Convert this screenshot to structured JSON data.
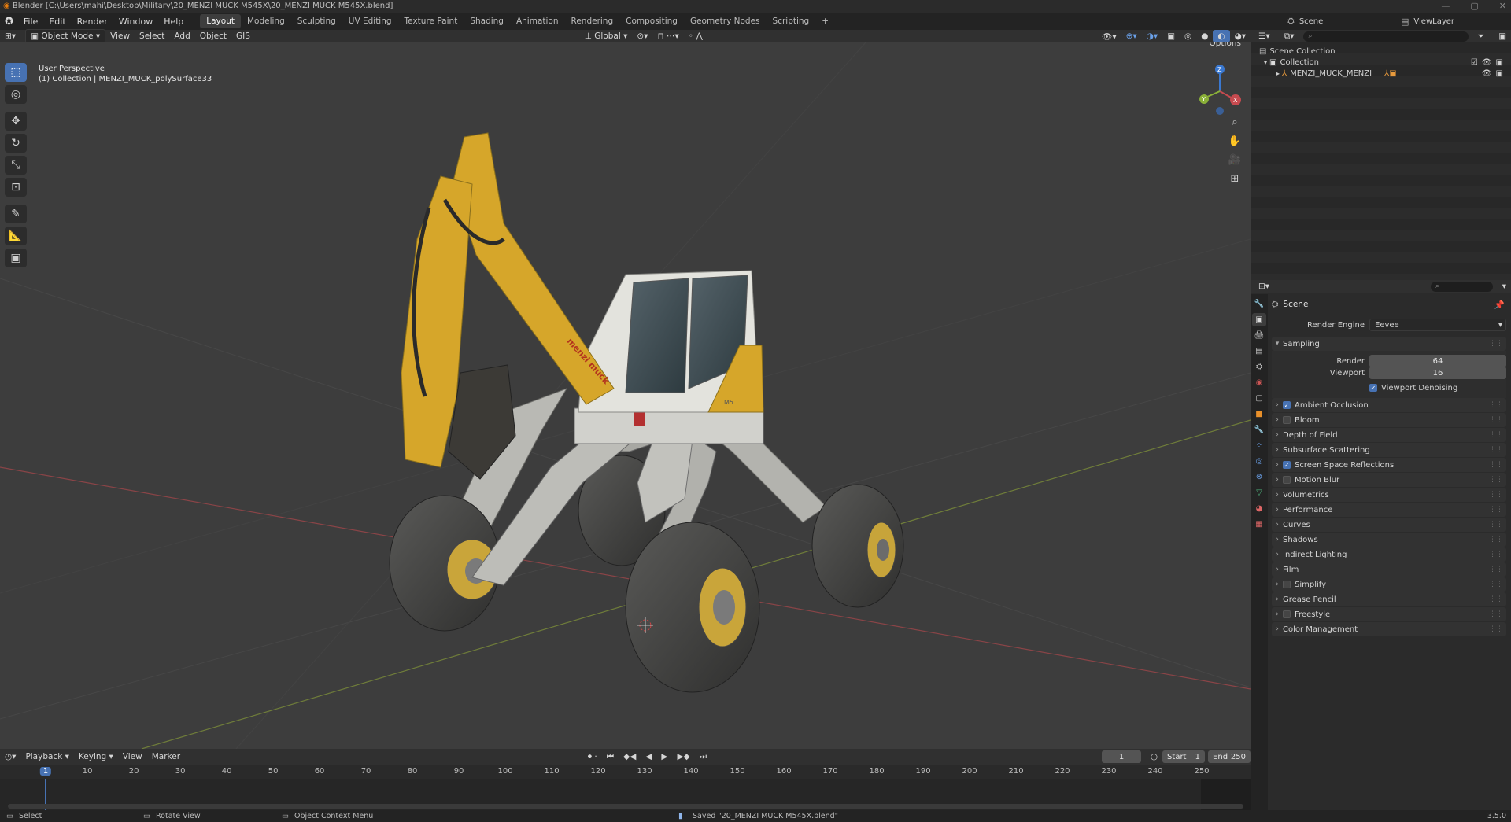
{
  "window": {
    "title": "Blender [C:\\Users\\mahi\\Desktop\\Military\\20_MENZI MUCK M545X\\20_MENZI MUCK M545X.blend]",
    "controls": [
      "—",
      "▢",
      "✕"
    ]
  },
  "menubar": {
    "menus": [
      "File",
      "Edit",
      "Render",
      "Window",
      "Help"
    ],
    "workspaces": [
      "Layout",
      "Modeling",
      "Sculpting",
      "UV Editing",
      "Texture Paint",
      "Shading",
      "Animation",
      "Rendering",
      "Compositing",
      "Geometry Nodes",
      "Scripting"
    ],
    "active_workspace": "Layout",
    "add_workspace": "+",
    "scene_label": "Scene",
    "viewlayer_label": "ViewLayer"
  },
  "viewport_header": {
    "mode": "Object Mode",
    "menus": [
      "View",
      "Select",
      "Add",
      "Object",
      "GIS"
    ],
    "orientation": "Global",
    "options_label": "Options"
  },
  "viewport": {
    "perspective_label": "User Perspective",
    "object_label": "(1) Collection | MENZI_MUCK_polySurface33",
    "gizmo": {
      "z": "Z",
      "y": "Y",
      "x": "X"
    },
    "vehicle_decal": "menzi muck",
    "model_tag": "M5"
  },
  "outliner": {
    "search_placeholder": "",
    "items": [
      {
        "label": "Scene Collection"
      },
      {
        "label": "Collection"
      },
      {
        "label": "MENZI_MUCK_MENZI"
      }
    ]
  },
  "properties": {
    "context": "Scene",
    "render_engine_label": "Render Engine",
    "render_engine_value": "Eevee",
    "sampling_label": "Sampling",
    "render_label": "Render",
    "render_value": "64",
    "viewport_label": "Viewport",
    "viewport_value": "16",
    "viewport_denoising_label": "Viewport Denoising",
    "panels": [
      {
        "label": "Ambient Occlusion",
        "checkbox": true,
        "checked": true
      },
      {
        "label": "Bloom",
        "checkbox": true,
        "checked": false
      },
      {
        "label": "Depth of Field",
        "checkbox": false
      },
      {
        "label": "Subsurface Scattering",
        "checkbox": false
      },
      {
        "label": "Screen Space Reflections",
        "checkbox": true,
        "checked": true
      },
      {
        "label": "Motion Blur",
        "checkbox": true,
        "checked": false
      },
      {
        "label": "Volumetrics",
        "checkbox": false
      },
      {
        "label": "Performance",
        "checkbox": false
      },
      {
        "label": "Curves",
        "checkbox": false
      },
      {
        "label": "Shadows",
        "checkbox": false
      },
      {
        "label": "Indirect Lighting",
        "checkbox": false
      },
      {
        "label": "Film",
        "checkbox": false
      },
      {
        "label": "Simplify",
        "checkbox": true,
        "checked": false
      },
      {
        "label": "Grease Pencil",
        "checkbox": false
      },
      {
        "label": "Freestyle",
        "checkbox": true,
        "checked": false
      },
      {
        "label": "Color Management",
        "checkbox": false
      }
    ]
  },
  "timeline": {
    "menus": [
      "Playback",
      "Keying",
      "View",
      "Marker"
    ],
    "current_frame": "1",
    "start_label": "Start",
    "start_value": "1",
    "end_label": "End",
    "end_value": "250",
    "ticks": [
      "1",
      "10",
      "20",
      "30",
      "40",
      "50",
      "60",
      "70",
      "80",
      "90",
      "100",
      "110",
      "120",
      "130",
      "140",
      "150",
      "160",
      "170",
      "180",
      "190",
      "200",
      "210",
      "220",
      "230",
      "240",
      "250"
    ]
  },
  "statusbar": {
    "select": "Select",
    "rotate": "Rotate View",
    "context_menu": "Object Context Menu",
    "message": "Saved \"20_MENZI MUCK M545X.blend\"",
    "version": "3.5.0"
  },
  "colors": {
    "accent": "#4772b3",
    "viewport_bg": "#3d3d3d",
    "machine_yellow": "#d6a62a",
    "x_axis": "#c74a4f",
    "y_axis": "#8ab038",
    "z_axis": "#3a78d0"
  }
}
